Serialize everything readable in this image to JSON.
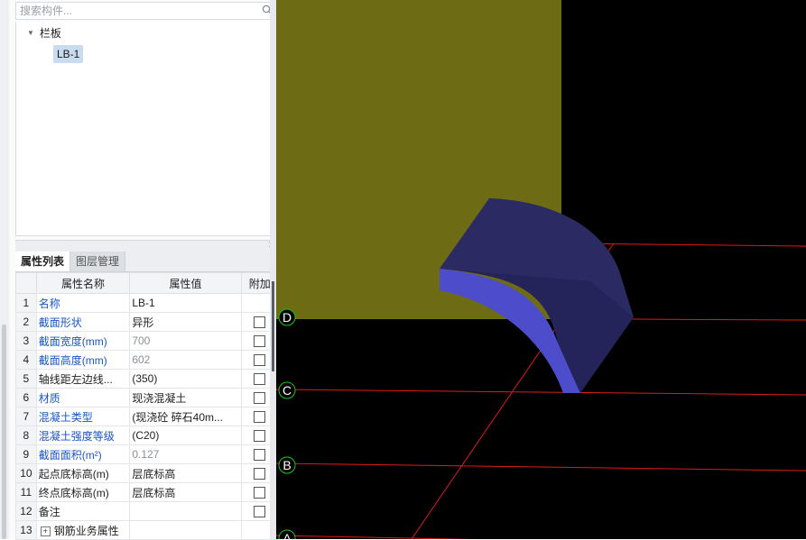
{
  "search": {
    "placeholder": "搜索构件..."
  },
  "tree": {
    "root_label": "栏板",
    "child_label": "LB-1"
  },
  "tabs": [
    "属性列表",
    "图层管理"
  ],
  "table": {
    "headers": [
      "属性名称",
      "属性值",
      "附加"
    ],
    "rows": [
      {
        "num": "1",
        "name": "名称",
        "value": "LB-1",
        "blue": true,
        "value_grey": false,
        "checkbox": false
      },
      {
        "num": "2",
        "name": "截面形状",
        "value": "异形",
        "blue": true,
        "value_grey": false,
        "checkbox": true
      },
      {
        "num": "3",
        "name": "截面宽度(mm)",
        "value": "700",
        "blue": true,
        "value_grey": true,
        "checkbox": true
      },
      {
        "num": "4",
        "name": "截面高度(mm)",
        "value": "602",
        "blue": true,
        "value_grey": true,
        "checkbox": true
      },
      {
        "num": "5",
        "name": "轴线距左边线...",
        "value": "(350)",
        "blue": false,
        "value_grey": false,
        "checkbox": true
      },
      {
        "num": "6",
        "name": "材质",
        "value": "现浇混凝土",
        "blue": true,
        "value_grey": false,
        "checkbox": true
      },
      {
        "num": "7",
        "name": "混凝土类型",
        "value": "(现浇砼 碎石40m...",
        "blue": true,
        "value_grey": false,
        "checkbox": true
      },
      {
        "num": "8",
        "name": "混凝土强度等级",
        "value": "(C20)",
        "blue": true,
        "value_grey": false,
        "checkbox": true
      },
      {
        "num": "9",
        "name": "截面面积(m²)",
        "value": "0.127",
        "blue": true,
        "value_grey": true,
        "checkbox": true
      },
      {
        "num": "10",
        "name": "起点底标高(m)",
        "value": "层底标高",
        "blue": false,
        "value_grey": false,
        "checkbox": true
      },
      {
        "num": "11",
        "name": "终点底标高(m)",
        "value": "层底标高",
        "blue": false,
        "value_grey": false,
        "checkbox": true
      },
      {
        "num": "12",
        "name": "备注",
        "value": "",
        "blue": false,
        "value_grey": false,
        "checkbox": true
      },
      {
        "num": "13",
        "name": "钢筋业务属性",
        "value": "",
        "blue": false,
        "value_grey": false,
        "checkbox": false,
        "expandable": true
      }
    ]
  },
  "axis_labels": [
    "D",
    "C",
    "B",
    "A"
  ],
  "colors": {
    "wall": "#6e6b15",
    "panel_top": "#2b2a63",
    "panel_face": "#4d4dcc",
    "grid_line": "#e01a1a",
    "axis_circle": "#16c916"
  },
  "icons": {
    "search": "search-icon",
    "close": "close-icon",
    "tree_arrow": "triangle-down-icon",
    "expand": "plus-box-icon"
  }
}
